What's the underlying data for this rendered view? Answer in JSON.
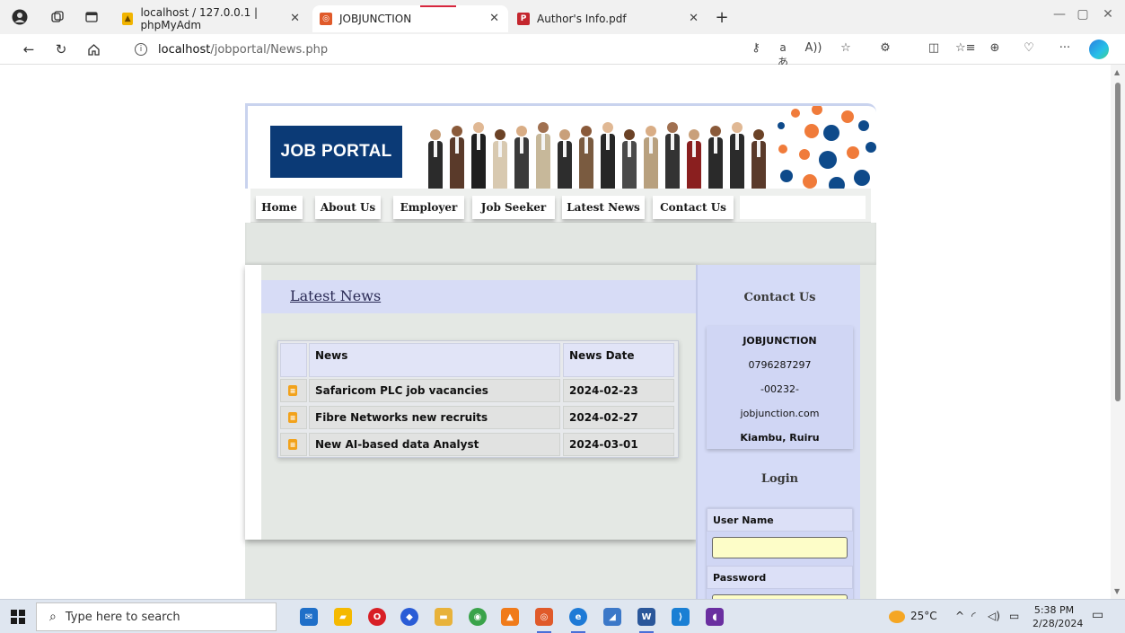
{
  "browser": {
    "tabs": [
      {
        "label": "localhost / 127.0.0.1 | phpMyAdm",
        "favicon": "phpmyadmin-icon",
        "active": false
      },
      {
        "label": "JOBJUNCTION",
        "favicon": "jobjunction-icon",
        "active": true
      },
      {
        "label": "Author's Info.pdf",
        "favicon": "pdf-icon",
        "active": false
      }
    ],
    "new_tab": "+",
    "address": {
      "host": "localhost",
      "path": "/jobportal/News.php"
    },
    "toolbar_icons": [
      "key-icon",
      "translate-icon",
      "read-aloud-icon",
      "favorite-icon",
      "extensions-icon",
      "split-screen-icon",
      "favorites-icon",
      "collections-icon",
      "performance-icon",
      "more-icon",
      "copilot-icon"
    ]
  },
  "site": {
    "logo": "JOB PORTAL",
    "menu": [
      "Home",
      "About Us",
      "Employer",
      "Job Seeker",
      "Latest News",
      "Contact Us"
    ],
    "news": {
      "heading": "Latest News",
      "columns": [
        "News",
        "News Date"
      ],
      "rows": [
        {
          "news": "Safaricom PLC job vacancies",
          "date": "2024-02-23"
        },
        {
          "news": "Fibre Networks new recruits",
          "date": "2024-02-27"
        },
        {
          "news": "New AI-based data Analyst",
          "date": "2024-03-01"
        }
      ]
    },
    "sidebar": {
      "contact_title": "Contact Us",
      "contact": {
        "name": "JOBJUNCTION",
        "phone": "0796287297",
        "postal": "-00232-",
        "web": "jobjunction.com",
        "location": "Kiambu, Ruiru"
      },
      "login_title": "Login",
      "username_label": "User Name",
      "password_label": "Password"
    }
  },
  "taskbar": {
    "search_placeholder": "Type here to search",
    "weather": "25°C",
    "time": "5:38 PM",
    "date": "2/28/2024"
  },
  "colors": {
    "logo_bg": "#0b3a76",
    "news_header_bg": "#d7dcf6",
    "sidebar_bg": "#d5dbf7",
    "input_bg": "#fdfdc8",
    "dot_orange": "#f07b3a",
    "dot_blue": "#0e4a8a"
  }
}
